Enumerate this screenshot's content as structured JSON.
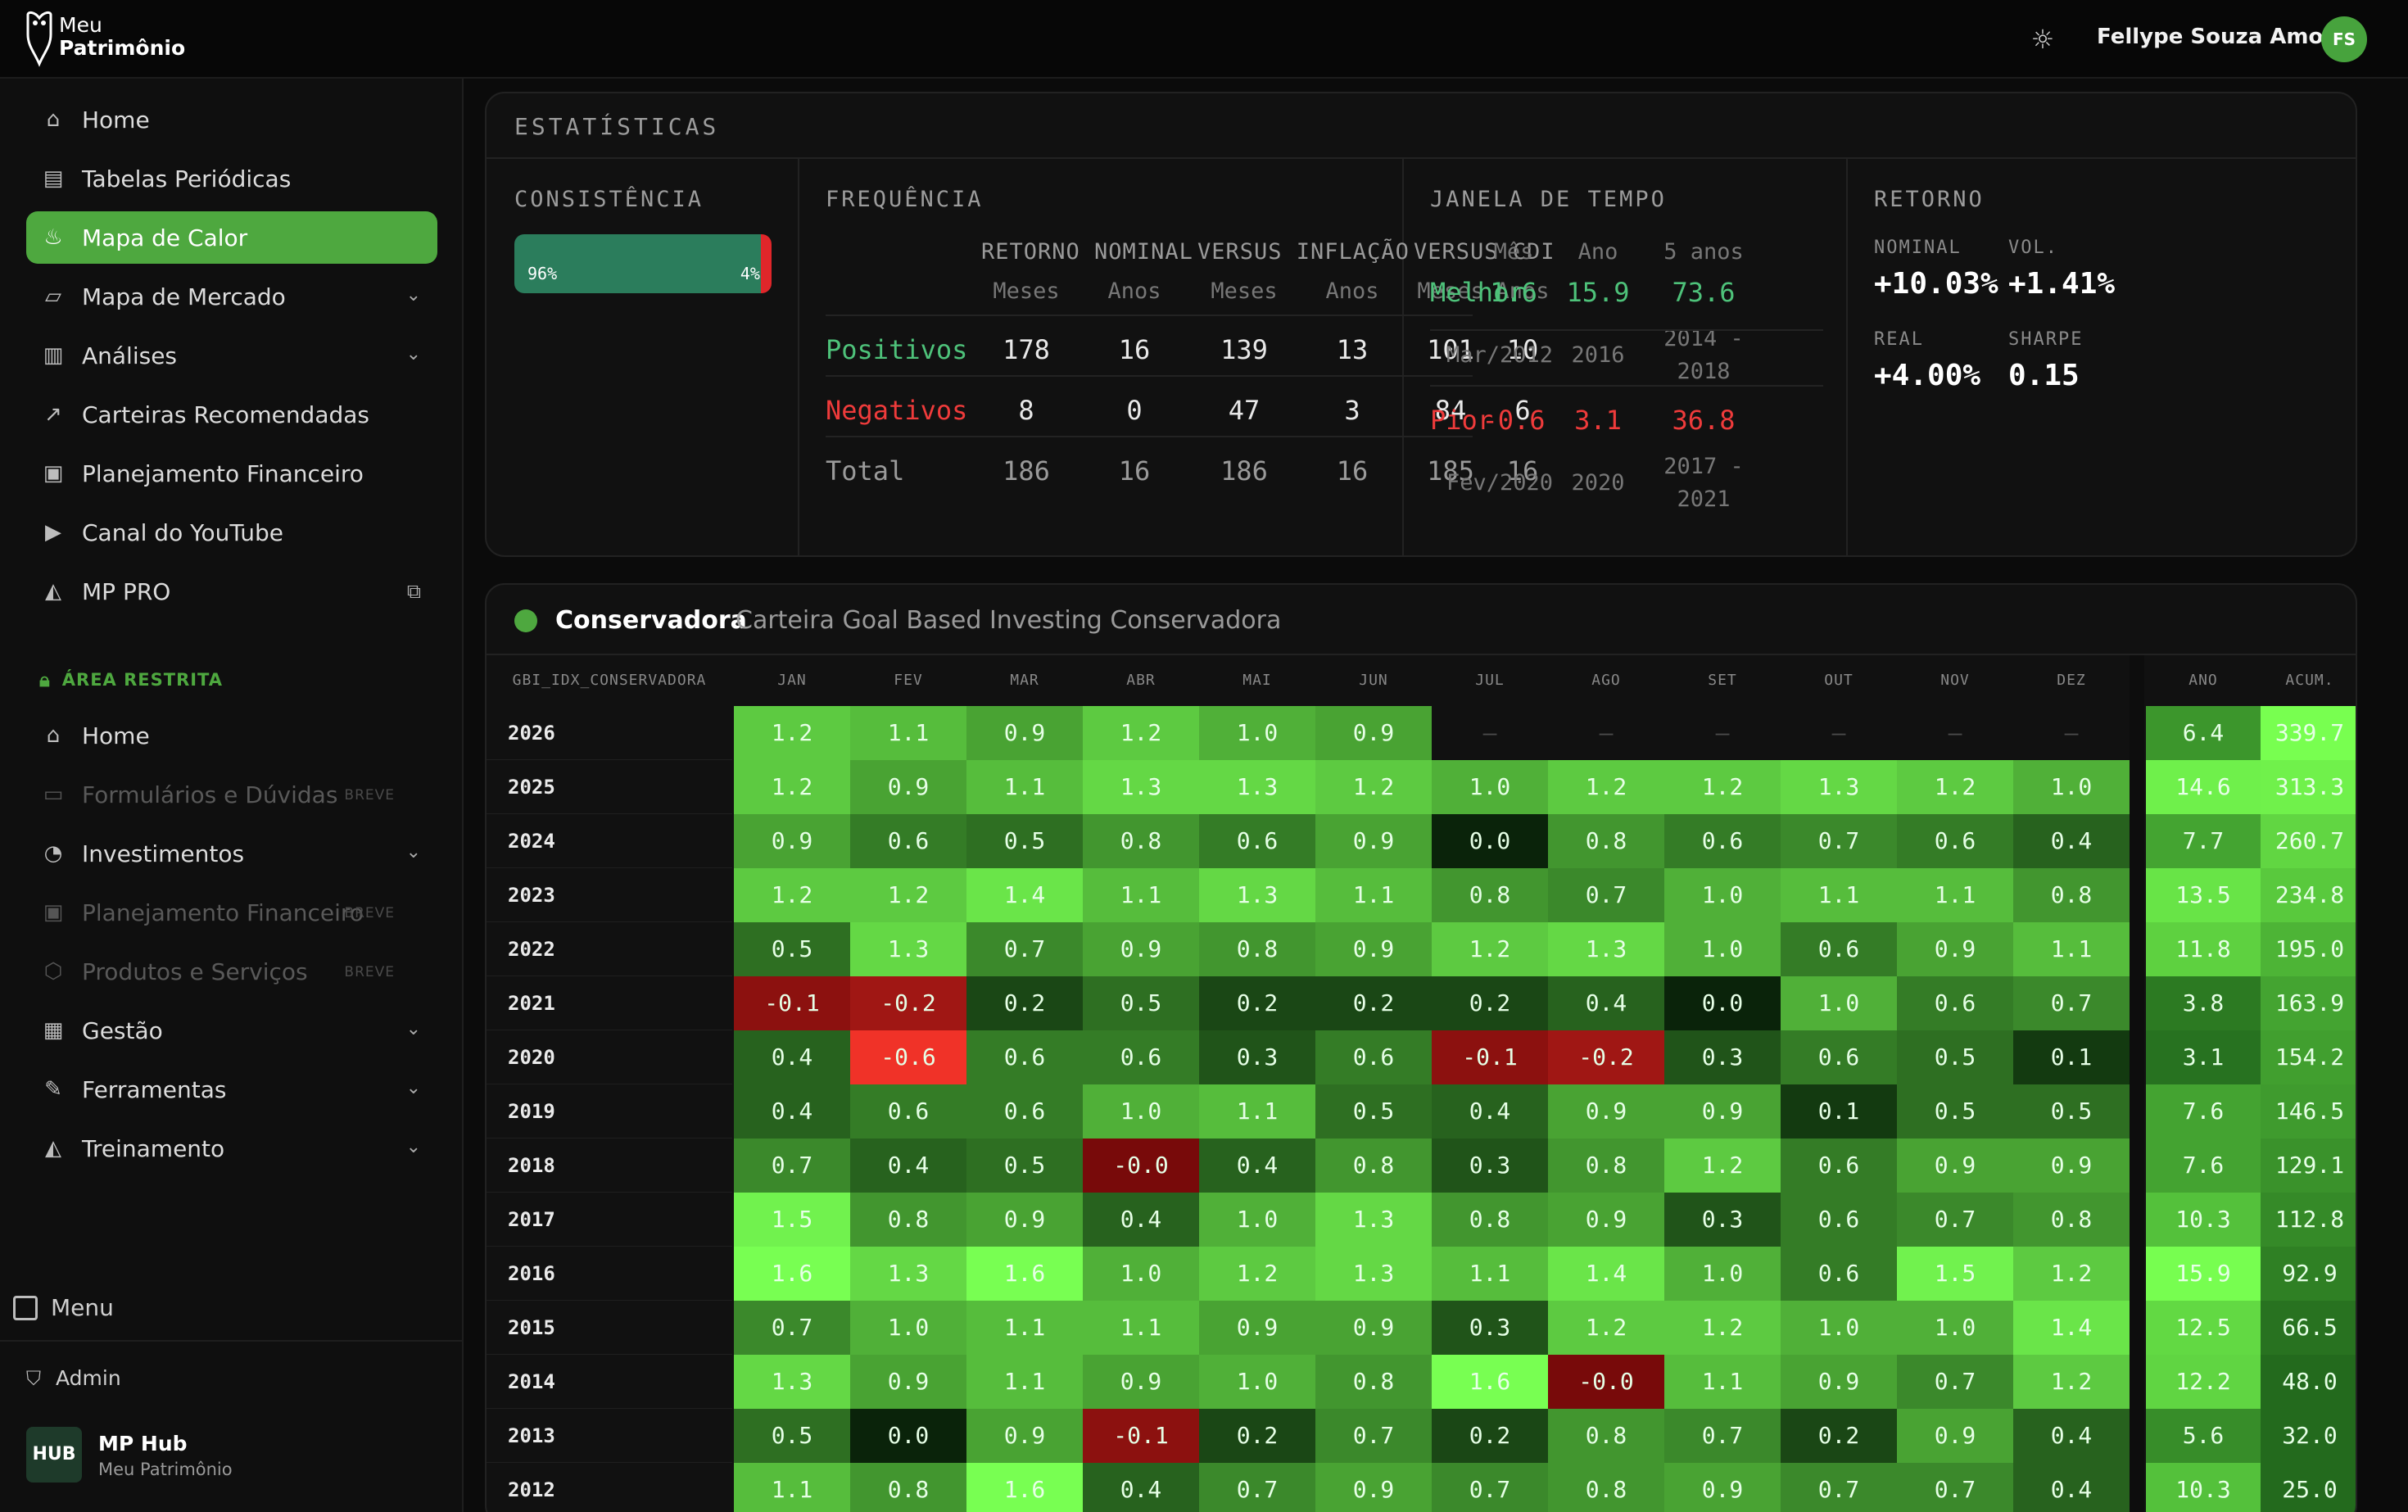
{
  "app": {
    "logo_line1": "Meu",
    "logo_line2": "Patrimônio"
  },
  "header": {
    "theme_icon": "sun-icon",
    "user_name": "Fellype Souza Amorim",
    "user_initials": "FS"
  },
  "sidebar": {
    "items": [
      {
        "label": "Home",
        "icon": "home-icon"
      },
      {
        "label": "Tabelas Periódicas",
        "icon": "table-icon"
      },
      {
        "label": "Mapa de Calor",
        "icon": "flame-icon",
        "active": true
      },
      {
        "label": "Mapa de Mercado",
        "icon": "map-icon",
        "chevron": true
      },
      {
        "label": "Análises",
        "icon": "bar-chart-icon",
        "chevron": true
      },
      {
        "label": "Carteiras Recomendadas",
        "icon": "trend-icon"
      },
      {
        "label": "Planejamento Financeiro",
        "icon": "wallet-icon"
      },
      {
        "label": "Canal do YouTube",
        "icon": "youtube-icon"
      },
      {
        "label": "MP PRO",
        "icon": "graduation-icon",
        "external": true
      }
    ],
    "restricted_label": "ÁREA RESTRITA",
    "restricted_items": [
      {
        "label": "Home",
        "icon": "home-icon"
      },
      {
        "label": "Formulários e Dúvidas",
        "icon": "form-icon",
        "badge": "BREVE",
        "disabled": true
      },
      {
        "label": "Investimentos",
        "icon": "pie-icon",
        "chevron": true
      },
      {
        "label": "Planejamento Financeiro",
        "icon": "wallet-icon",
        "badge": "BREVE",
        "disabled": true
      },
      {
        "label": "Produtos e Serviços",
        "icon": "box-icon",
        "badge": "BREVE",
        "disabled": true
      },
      {
        "label": "Gestão",
        "icon": "building-icon",
        "chevron": true
      },
      {
        "label": "Ferramentas",
        "icon": "wrench-icon",
        "chevron": true
      },
      {
        "label": "Treinamento",
        "icon": "graduation-icon",
        "chevron": true
      }
    ],
    "menu_label": "Menu",
    "admin_label": "Admin",
    "hub_logo": "HUB",
    "hub_name": "MP Hub",
    "hub_sub": "Meu Patrimônio"
  },
  "stats": {
    "title": "ESTATÍSTICAS",
    "consistencia": {
      "title": "CONSISTÊNCIA",
      "positive_pct": 96,
      "negative_pct": 4,
      "positive_label": "96%",
      "negative_label": "4%"
    },
    "frequencia": {
      "title": "FREQUÊNCIA",
      "groups": [
        "RETORNO NOMINAL",
        "VERSUS INFLAÇÃO",
        "VERSUS CDI"
      ],
      "subs": [
        "Meses",
        "Anos",
        "Meses",
        "Anos",
        "Meses",
        "Anos"
      ],
      "rows": [
        {
          "label": "Positivos",
          "values": [
            "178",
            "16",
            "139",
            "13",
            "101",
            "10"
          ]
        },
        {
          "label": "Negativos",
          "values": [
            "8",
            "0",
            "47",
            "3",
            "84",
            "6"
          ]
        },
        {
          "label": "Total",
          "values": [
            "186",
            "16",
            "186",
            "16",
            "185",
            "16"
          ]
        }
      ]
    },
    "janela": {
      "title": "JANELA DE TEMPO",
      "headers": [
        "Mês",
        "Ano",
        "5 anos"
      ],
      "best": {
        "label": "Melhor",
        "values": [
          "1.6",
          "15.9",
          "73.6"
        ],
        "dates": [
          "Mar/2012",
          "2016",
          "2014 -",
          "2018"
        ]
      },
      "worst": {
        "label": "Pior",
        "values": [
          "-0.6",
          "3.1",
          "36.8"
        ],
        "dates": [
          "Fev/2020",
          "2020",
          "2017 -",
          "2021"
        ]
      }
    },
    "retorno": {
      "title": "RETORNO",
      "nominal_label": "NOMINAL",
      "nominal_value": "+10.03%",
      "vol_label": "VOL.",
      "vol_value": "+1.41%",
      "real_label": "REAL",
      "real_value": "+4.00%",
      "sharpe_label": "SHARPE",
      "sharpe_value": "0.15"
    }
  },
  "heatmap": {
    "name": "Conservadora",
    "description": "Carteira Goal Based Investing Conservadora",
    "index_label": "GBI_IDX_CONSERVADORA",
    "months": [
      "JAN",
      "FEV",
      "MAR",
      "ABR",
      "MAI",
      "JUN",
      "JUL",
      "AGO",
      "SET",
      "OUT",
      "NOV",
      "DEZ"
    ],
    "ano_label": "ANO",
    "acum_label": "ACUM.",
    "rows": [
      {
        "year": "2026",
        "values": [
          "1.2",
          "1.1",
          "0.9",
          "1.2",
          "1.0",
          "0.9",
          "—",
          "—",
          "—",
          "—",
          "—",
          "—"
        ],
        "ano": "6.4",
        "acum": "339.7"
      },
      {
        "year": "2025",
        "values": [
          "1.2",
          "0.9",
          "1.1",
          "1.3",
          "1.3",
          "1.2",
          "1.0",
          "1.2",
          "1.2",
          "1.3",
          "1.2",
          "1.0"
        ],
        "ano": "14.6",
        "acum": "313.3"
      },
      {
        "year": "2024",
        "values": [
          "0.9",
          "0.6",
          "0.5",
          "0.8",
          "0.6",
          "0.9",
          "0.0",
          "0.8",
          "0.6",
          "0.7",
          "0.6",
          "0.4"
        ],
        "ano": "7.7",
        "acum": "260.7"
      },
      {
        "year": "2023",
        "values": [
          "1.2",
          "1.2",
          "1.4",
          "1.1",
          "1.3",
          "1.1",
          "0.8",
          "0.7",
          "1.0",
          "1.1",
          "1.1",
          "0.8"
        ],
        "ano": "13.5",
        "acum": "234.8"
      },
      {
        "year": "2022",
        "values": [
          "0.5",
          "1.3",
          "0.7",
          "0.9",
          "0.8",
          "0.9",
          "1.2",
          "1.3",
          "1.0",
          "0.6",
          "0.9",
          "1.1"
        ],
        "ano": "11.8",
        "acum": "195.0"
      },
      {
        "year": "2021",
        "values": [
          "-0.1",
          "-0.2",
          "0.2",
          "0.5",
          "0.2",
          "0.2",
          "0.2",
          "0.4",
          "0.0",
          "1.0",
          "0.6",
          "0.7"
        ],
        "ano": "3.8",
        "acum": "163.9"
      },
      {
        "year": "2020",
        "values": [
          "0.4",
          "-0.6",
          "0.6",
          "0.6",
          "0.3",
          "0.6",
          "-0.1",
          "-0.2",
          "0.3",
          "0.6",
          "0.5",
          "0.1"
        ],
        "ano": "3.1",
        "acum": "154.2"
      },
      {
        "year": "2019",
        "values": [
          "0.4",
          "0.6",
          "0.6",
          "1.0",
          "1.1",
          "0.5",
          "0.4",
          "0.9",
          "0.9",
          "0.1",
          "0.5",
          "0.5"
        ],
        "ano": "7.6",
        "acum": "146.5"
      },
      {
        "year": "2018",
        "values": [
          "0.7",
          "0.4",
          "0.5",
          "-0.0",
          "0.4",
          "0.8",
          "0.3",
          "0.8",
          "1.2",
          "0.6",
          "0.9",
          "0.9"
        ],
        "ano": "7.6",
        "acum": "129.1"
      },
      {
        "year": "2017",
        "values": [
          "1.5",
          "0.8",
          "0.9",
          "0.4",
          "1.0",
          "1.3",
          "0.8",
          "0.9",
          "0.3",
          "0.6",
          "0.7",
          "0.8"
        ],
        "ano": "10.3",
        "acum": "112.8"
      },
      {
        "year": "2016",
        "values": [
          "1.6",
          "1.3",
          "1.6",
          "1.0",
          "1.2",
          "1.3",
          "1.1",
          "1.4",
          "1.0",
          "0.6",
          "1.5",
          "1.2"
        ],
        "ano": "15.9",
        "acum": "92.9"
      },
      {
        "year": "2015",
        "values": [
          "0.7",
          "1.0",
          "1.1",
          "1.1",
          "0.9",
          "0.9",
          "0.3",
          "1.2",
          "1.2",
          "1.0",
          "1.0",
          "1.4"
        ],
        "ano": "12.5",
        "acum": "66.5"
      },
      {
        "year": "2014",
        "values": [
          "1.3",
          "0.9",
          "1.1",
          "0.9",
          "1.0",
          "0.8",
          "1.6",
          "-0.0",
          "1.1",
          "0.9",
          "0.7",
          "1.2"
        ],
        "ano": "12.2",
        "acum": "48.0"
      },
      {
        "year": "2013",
        "values": [
          "0.5",
          "0.0",
          "0.9",
          "-0.1",
          "0.2",
          "0.7",
          "0.2",
          "0.8",
          "0.7",
          "0.2",
          "0.9",
          "0.4"
        ],
        "ano": "5.6",
        "acum": "32.0"
      },
      {
        "year": "2012",
        "values": [
          "1.1",
          "0.8",
          "1.6",
          "0.4",
          "0.7",
          "0.9",
          "0.7",
          "0.8",
          "0.9",
          "0.7",
          "0.7",
          "0.4"
        ],
        "ano": "10.3",
        "acum": "25.0"
      }
    ]
  },
  "colors": {
    "accent": "#4ea83f",
    "positive_text": "#4ec27a",
    "negative_text": "#ef3b3b"
  }
}
